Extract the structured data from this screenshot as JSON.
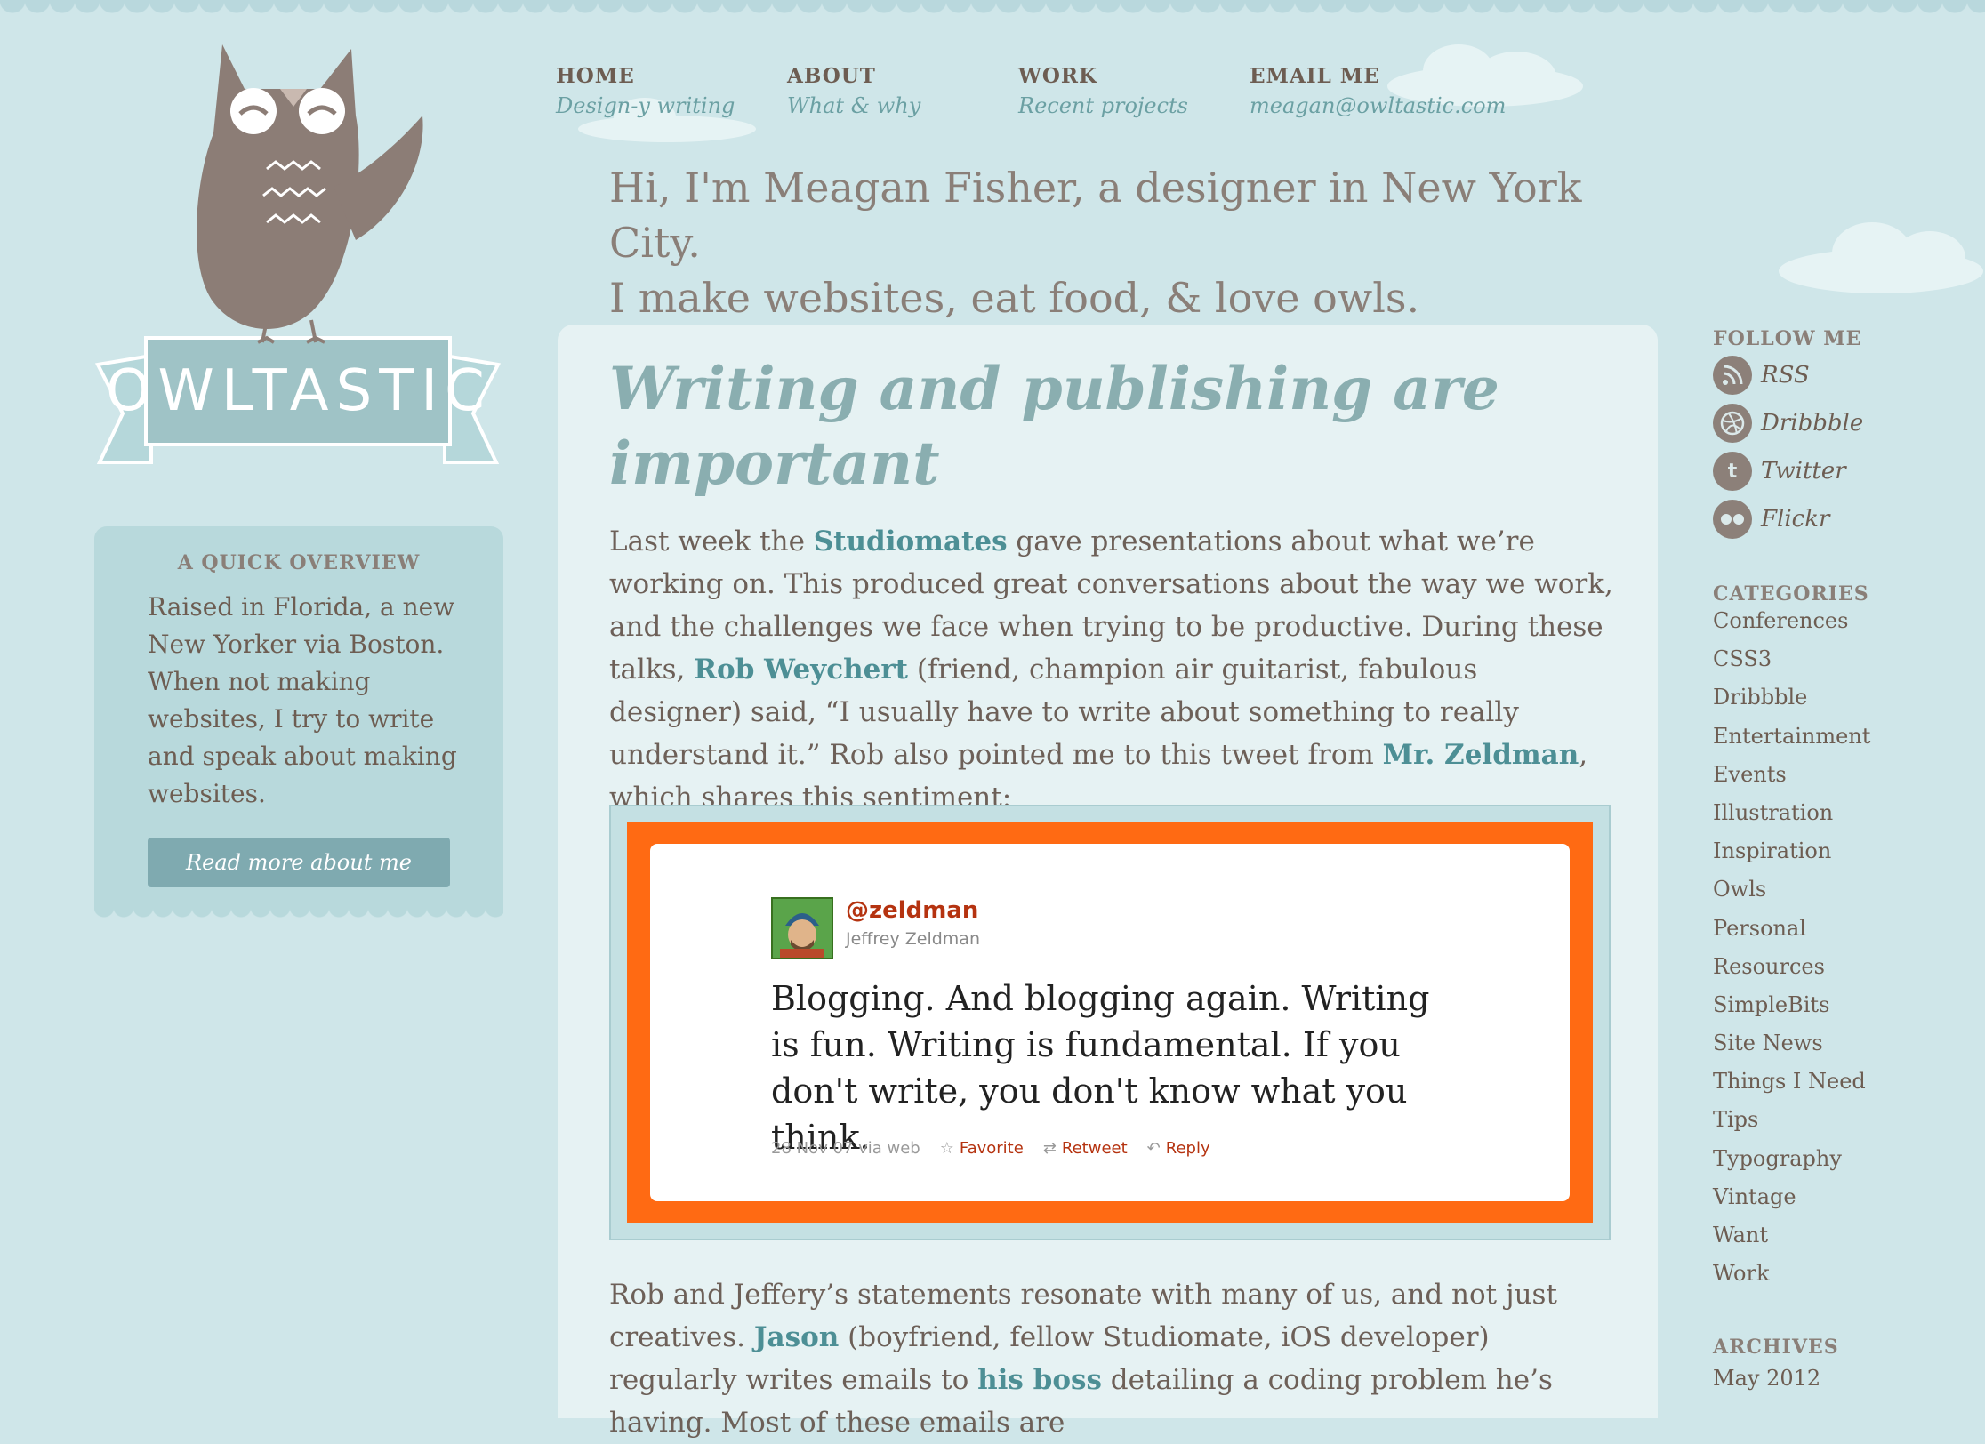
{
  "logo": {
    "text": "OWLTASTIC"
  },
  "nav": [
    {
      "title": "HOME",
      "sub": "Design-y writing"
    },
    {
      "title": "ABOUT",
      "sub": "What & why"
    },
    {
      "title": "WORK",
      "sub": "Recent projects"
    },
    {
      "title": "EMAIL ME",
      "sub": "meagan@owltastic.com"
    }
  ],
  "intro": {
    "line1": "Hi, I'm Meagan Fisher, a designer in New York City.",
    "line2": "I make websites, eat food, & love owls."
  },
  "overview": {
    "heading": "A QUICK OVERVIEW",
    "text": "Raised in Florida, a new New Yorker via Boston. When not making websites, I try to write and speak about making websites.",
    "button": "Read more about me"
  },
  "article": {
    "title": "Writing and publishing are important",
    "p1": {
      "t1": "Last week the ",
      "link1": "Studiomates",
      "t2": " gave presentations about what we’re working on. This produced great conversations about the way we work, and the challenges we face when trying to be productive. During these talks, ",
      "link2": "Rob Weychert",
      "t3": " (friend, champion air guitarist, fabulous designer) said, “I usually have to write about something to really understand it.” Rob also pointed me to this tweet from ",
      "link3": "Mr. Zeldman",
      "t4": ", which shares this sentiment:"
    },
    "tweet": {
      "handle": "@zeldman",
      "name": "Jeffrey Zeldman",
      "text": "Blogging. And blogging again. Writing is fun. Writing is fundamental. If you don't write, you don't know what you think.",
      "date": "28 Nov 07 via web",
      "favorite": "Favorite",
      "retweet": "Retweet",
      "reply": "Reply"
    },
    "p2": {
      "t1": "Rob and Jeffery’s statements resonate with many of us, and not just creatives. ",
      "link1": "Jason",
      "t2": " (boyfriend, fellow Studiomate, iOS developer) regularly writes emails to ",
      "link2": "his boss",
      "t3": " detailing a coding problem he’s having. Most of these emails are"
    }
  },
  "follow": {
    "heading": "FOLLOW ME",
    "items": [
      {
        "label": "RSS",
        "icon": "rss-icon"
      },
      {
        "label": "Dribbble",
        "icon": "dribbble-icon"
      },
      {
        "label": "Twitter",
        "icon": "twitter-icon"
      },
      {
        "label": "Flickr",
        "icon": "flickr-icon"
      }
    ]
  },
  "categories": {
    "heading": "CATEGORIES",
    "items": [
      "Conferences",
      "CSS3",
      "Dribbble",
      "Entertainment",
      "Events",
      "Illustration",
      "Inspiration",
      "Owls",
      "Personal",
      "Resources",
      "SimpleBits",
      "Site News",
      "Things I Need",
      "Tips",
      "Typography",
      "Vintage",
      "Want",
      "Work"
    ]
  },
  "archives": {
    "heading": "ARCHIVES",
    "items": [
      "May 2012"
    ]
  },
  "colors": {
    "background": "#cfe6e9",
    "accent": "#4d8f95",
    "owl": "#8c7d76",
    "tweet_frame": "#ff6a13",
    "tweet_handle": "#b53310"
  }
}
